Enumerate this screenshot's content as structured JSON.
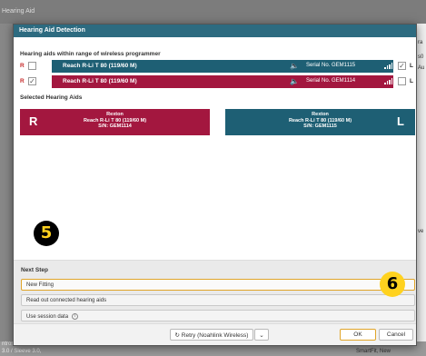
{
  "background": {
    "title_fragment": "Hearing Aid",
    "right_labels": [
      "ra",
      "s0",
      "Au",
      "ve"
    ],
    "bottom_left_1": "ntros",
    "bottom_left_2": "3.0 / Sleeve 3.0,",
    "bottom_right": "SmartFit, New"
  },
  "dialog": {
    "title": "Hearing Aid Detection",
    "in_range_label": "Hearing aids within range of wireless programmer",
    "selected_label": "Selected Hearing Aids",
    "next_step_label": "Next Step"
  },
  "in_range": [
    {
      "side": "R",
      "checked": false,
      "device": "Reach R-Li T 80 (119/60 M)",
      "speaker_icon": "speaker-icon",
      "serial": "Serial No. GEM1115",
      "signal_icon": "signal-icon",
      "right_checked": true,
      "right_side": "L",
      "color": "#1e5f74"
    },
    {
      "side": "R",
      "checked": true,
      "device": "Reach R-Li T 80 (119/60 M)",
      "speaker_icon": "speaker-icon",
      "serial": "Serial No. GEM1114",
      "signal_icon": "signal-icon",
      "right_checked": false,
      "right_side": "L",
      "color": "#a3173f"
    }
  ],
  "selected": {
    "right": {
      "letter": "R",
      "brand": "Rexton",
      "model": "Reach R-Li T 80 (119/60 M)",
      "sn": "S/N: GEM1114",
      "color": "#a3173f"
    },
    "left": {
      "letter": "L",
      "brand": "Rexton",
      "model": "Reach R-Li T 80 (119/60 M)",
      "sn": "S/N: GEM1115",
      "color": "#1e5f74"
    }
  },
  "next_steps": [
    {
      "label": "New Fitting",
      "active": true
    },
    {
      "label": "Read out connected hearing aids",
      "active": false
    },
    {
      "label": "Use session data",
      "active": false,
      "info_icon": "info-icon"
    }
  ],
  "footer": {
    "retry_label": "Retry (Noahlink Wireless)",
    "retry_icon": "refresh-icon",
    "dropdown_icon": "chevron-down-icon",
    "ok_label": "OK",
    "cancel_label": "Cancel"
  },
  "callouts": {
    "five": "5",
    "six": "6"
  },
  "check_mark": "✓"
}
